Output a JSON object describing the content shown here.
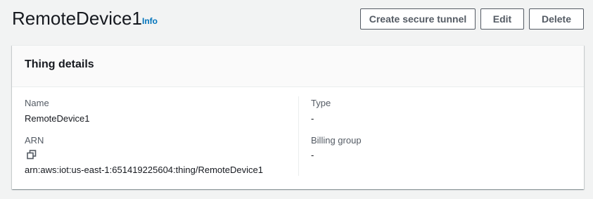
{
  "header": {
    "title": "RemoteDevice1",
    "info_label": "Info",
    "buttons": {
      "create_tunnel": "Create secure tunnel",
      "edit": "Edit",
      "delete": "Delete"
    }
  },
  "panel": {
    "title": "Thing details",
    "fields": {
      "name_label": "Name",
      "name_value": "RemoteDevice1",
      "arn_label": "ARN",
      "arn_value": "arn:aws:iot:us-east-1:651419225604:thing/RemoteDevice1",
      "arn_copy_icon": "copy-icon",
      "type_label": "Type",
      "type_value": "-",
      "billing_group_label": "Billing group",
      "billing_group_value": "-"
    }
  },
  "colors": {
    "background": "#f2f3f3",
    "panel": "#ffffff",
    "panel_header": "#fafafa",
    "link": "#0073bb",
    "button_border": "#545b64",
    "text": "#16191f",
    "label": "#545b64"
  }
}
